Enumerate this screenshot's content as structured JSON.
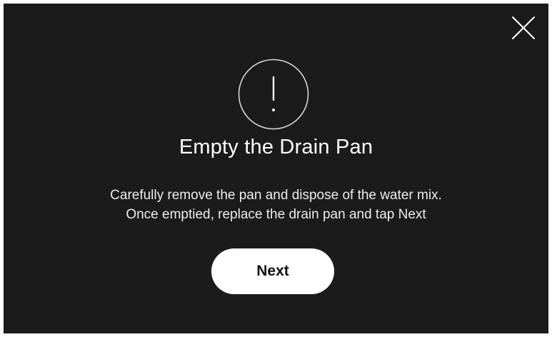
{
  "dialog": {
    "close_icon": "close-icon",
    "alert_icon": "exclamation-icon",
    "title": "Empty the Drain Pan",
    "message_line1": "Carefully remove the pan and dispose of the water mix.",
    "message_line2": "Once emptied, replace the drain pan and tap Next",
    "next_label": "Next"
  },
  "colors": {
    "background": "#1b1b1b",
    "text": "#ffffff",
    "button_bg": "#ffffff",
    "button_text": "#111111"
  }
}
